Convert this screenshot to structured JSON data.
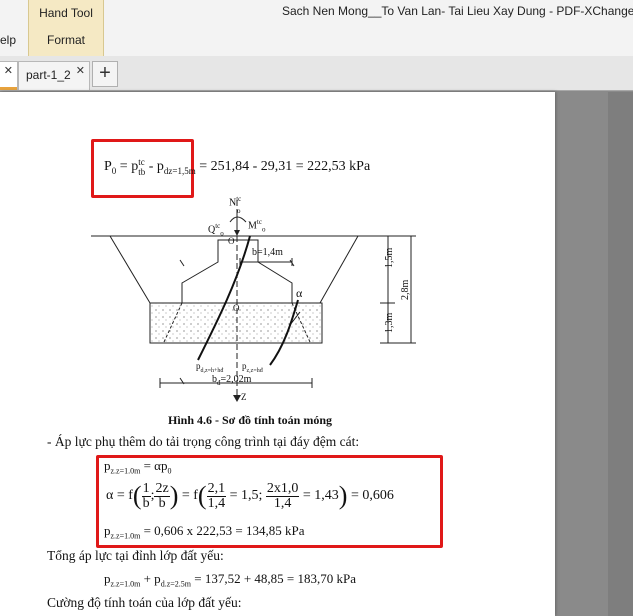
{
  "app": {
    "title": "Sach Nen Mong__To Van Lan- Tai Lieu Xay Dung - PDF-XChange Ed",
    "menu_help": "elp",
    "ribbon_group_top": "Hand Tool",
    "ribbon_group_bottom": "Format"
  },
  "tabs": [
    {
      "label": ""
    },
    {
      "label": "part-1_2"
    }
  ],
  "document": {
    "formula1": {
      "lhs": "P",
      "lhs_sub": "0",
      "eq": " = p",
      "sup": "tc",
      "sub": "tb",
      "minus": " - p",
      "sub2": "dz=1,5m",
      "rest": " = 251,84 - 29,31 = 222,53 kPa"
    },
    "figure_labels": {
      "N": "N",
      "N_sup": "tc",
      "N_sub": "o",
      "Q": "Q",
      "Q_sup": "tc",
      "Q_sub": "o",
      "M": "M",
      "M_sup": "tc",
      "M_sub": "o",
      "O1": "O",
      "O2": "O",
      "b": "b=1,4m",
      "alpha": "α",
      "dim1": "1,5m",
      "dim2": "2,8m",
      "dim3": "1,3m",
      "p1": "p",
      "p1_sub": "d,z=h+hđ",
      "p2": "p",
      "p2_sub": "z,z=hđ",
      "bd": "b",
      "bd_sub": "đ",
      "bd_val": "=2,02m",
      "z": "Z"
    },
    "caption": "Hình 4.6 - Sơ đồ tính toán móng",
    "line1": "- Áp lực phụ thêm do tải trọng công trình tại đáy đệm cát:",
    "box2": {
      "l1_p": "p",
      "l1_sub": "z.z=1.0m",
      "l1_rest": " = αp",
      "l1_sub2": "0",
      "l2_alpha": "α = f",
      "l2_f1n": "1",
      "l2_f1d": "b",
      "l2_f2n": "2z",
      "l2_f2d": "b",
      "l2_eq": "= f",
      "l2_f3n": "2,1",
      "l2_f3d": "1,4",
      "l2_mid": "= 1,5;",
      "l2_f4n": "2x1,0",
      "l2_f4d": "1,4",
      "l2_end": "= 1,43",
      "l2_result": "= 0,606",
      "l3_p": "p",
      "l3_sub": "z.z=1.0m",
      "l3_rest": " = 0,606 x 222,53 = 134,85 kPa"
    },
    "line2": "Tổng áp lực tại đỉnh lớp đất yếu:",
    "formula3": {
      "p": "p",
      "sub": "z.z=1.0m",
      "plus": " + p",
      "sub2": "d.z=2.5m",
      "rest": " = 137,52 + 48,85 = 183,70 kPa"
    },
    "line3": "Cường độ tính toán của lớp đất yếu:"
  },
  "colors": {
    "highlight_box": "#e01818",
    "ribbon_group": "#f5e9c4",
    "active_tab_bar": "#e8a33d"
  }
}
